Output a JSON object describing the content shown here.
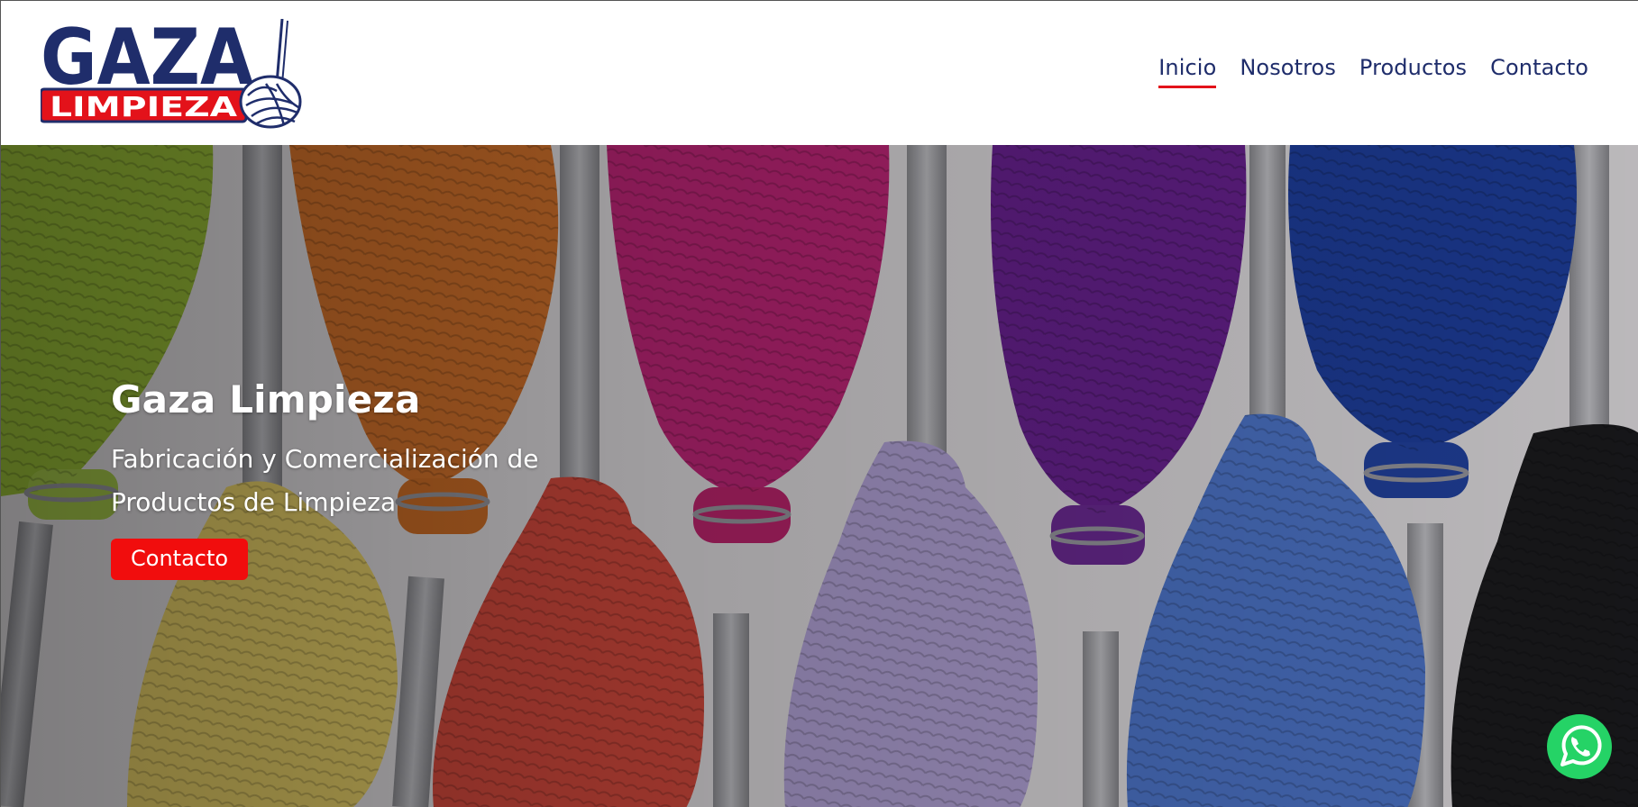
{
  "brand": {
    "logo_top": "GAZA",
    "logo_bottom": "LIMPIEZA",
    "primary": "#1f2d6b",
    "accent": "#e3121a"
  },
  "nav": {
    "items": [
      {
        "label": "Inicio",
        "active": true
      },
      {
        "label": "Nosotros",
        "active": false
      },
      {
        "label": "Productos",
        "active": false
      },
      {
        "label": "Contacto",
        "active": false
      }
    ]
  },
  "hero": {
    "title": "Gaza Limpieza",
    "subtitle_line1": "Fabricación y Comercialización de",
    "subtitle_line2": "Productos de Limpieza",
    "button_label": "Contacto",
    "button_color": "#f10d0d"
  },
  "whatsapp": {
    "icon": "whatsapp-icon",
    "color": "#25d366"
  }
}
